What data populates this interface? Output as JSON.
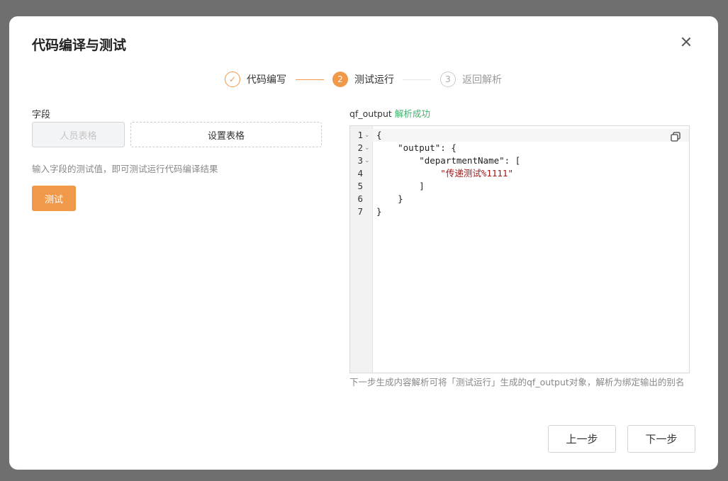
{
  "dialog": {
    "title": "代码编译与测试"
  },
  "steps": [
    {
      "number": "✓",
      "label": "代码编写",
      "status": "done"
    },
    {
      "number": "2",
      "label": "测试运行",
      "status": "active"
    },
    {
      "number": "3",
      "label": "返回解析",
      "status": "todo"
    }
  ],
  "left": {
    "field_label": "字段",
    "field_name_placeholder": "人员表格",
    "field_value_button": "设置表格",
    "hint": "输入字段的测试值，即可测试运行代码编译结果",
    "test_button": "测试"
  },
  "output": {
    "label": "qf_output",
    "status": "解析成功",
    "line_numbers": [
      "1",
      "2",
      "3",
      "4",
      "5",
      "6",
      "7"
    ],
    "code_lines": [
      "{",
      "    \"output\": {",
      "        \"departmentName\": [",
      "            \"传递测试%1111\"",
      "        ]",
      "    }",
      "}"
    ],
    "note": "下一步生成内容解析可将「测试运行」生成的qf_output对象，解析为绑定输出的别名"
  },
  "footer": {
    "prev_button": "上一步",
    "next_button": "下一步"
  },
  "colors": {
    "accent": "#f0994a",
    "success": "#3eb36b",
    "string": "#a31515"
  }
}
